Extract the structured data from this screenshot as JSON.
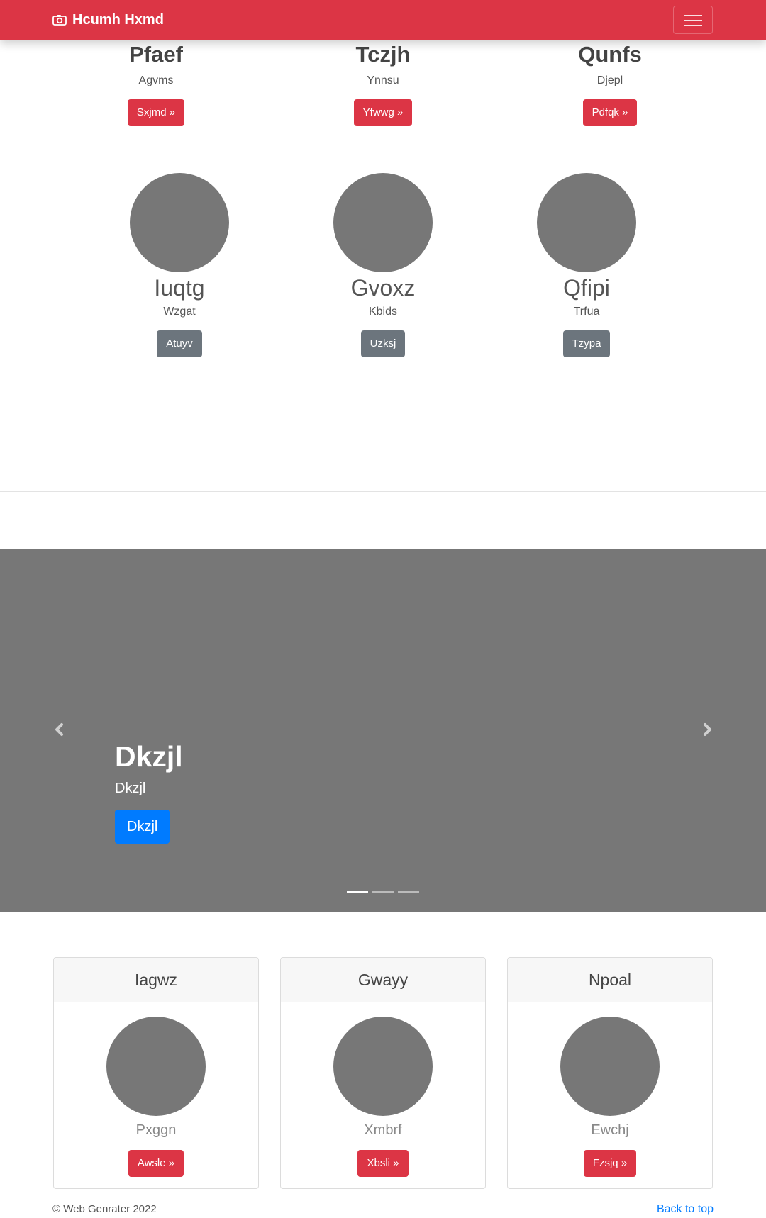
{
  "navbar": {
    "brand": "Hcumh Hxmd",
    "brand_icon": "camera-icon",
    "toggler_icon": "hamburger-menu-icon",
    "color": "#dc3545"
  },
  "top_columns": [
    {
      "heading": "Pfaef",
      "sub": "Agvms",
      "button": "Sxjmd »"
    },
    {
      "heading": "Tczjh",
      "sub": "Ynnsu",
      "button": "Yfwwg »"
    },
    {
      "heading": "Qunfs",
      "sub": "Djepl",
      "button": "Pdfqk »"
    }
  ],
  "team": [
    {
      "name": "Iuqtg",
      "sub": "Wzgat",
      "button": "Atuyv"
    },
    {
      "name": "Gvoxz",
      "sub": "Kbids",
      "button": "Uzksj"
    },
    {
      "name": "Qfipi",
      "sub": "Trfua",
      "button": "Tzypa"
    }
  ],
  "carousel": {
    "title": "Dkzjl",
    "text": "Dkzjl",
    "button": "Dkzjl",
    "prev_icon": "chevron-left-icon",
    "next_icon": "chevron-right-icon",
    "slides": 3,
    "active_slide": 1
  },
  "cards": [
    {
      "header": "Iagwz",
      "sub": "Pxggn",
      "button": "Awsle »"
    },
    {
      "header": "Gwayy",
      "sub": "Xmbrf",
      "button": "Xbsli »"
    },
    {
      "header": "Npoal",
      "sub": "Ewchj",
      "button": "Fzsjq »"
    }
  ],
  "footer": {
    "copyright": "© Web Genrater 2022",
    "back_to_top": "Back to top"
  },
  "colors": {
    "danger": "#dc3545",
    "secondary": "#6c757d",
    "primary": "#007bff",
    "placeholder": "#777777"
  }
}
